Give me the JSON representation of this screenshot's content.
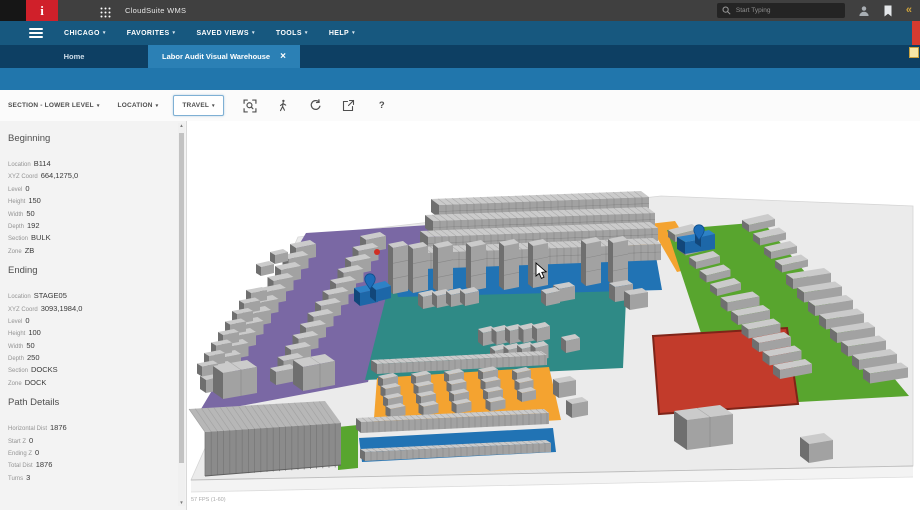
{
  "topbar": {
    "logo_letter": "i",
    "app_title": "CloudSuite WMS",
    "search_placeholder": "Start Typing"
  },
  "menubar": {
    "items": [
      "CHICAGO",
      "FAVORITES",
      "SAVED VIEWS",
      "TOOLS",
      "HELP"
    ]
  },
  "tabs": {
    "items": [
      {
        "label": "Home",
        "active": false
      },
      {
        "label": "Labor Audit Visual Warehouse",
        "active": true,
        "closable": true
      }
    ]
  },
  "toolbar": {
    "dropdowns": [
      "SECTION - LOWER LEVEL",
      "LOCATION",
      "TRAVEL"
    ],
    "icons": [
      "zoom-fit-icon",
      "walk-icon",
      "refresh-icon",
      "export-icon",
      "help-icon"
    ]
  },
  "panel": {
    "sections": [
      {
        "title": "Beginning",
        "fields": [
          {
            "label": "Location",
            "value": "B114"
          },
          {
            "label": "XYZ Coord",
            "value": "664,1275,0"
          },
          {
            "label": "Level",
            "value": "0"
          },
          {
            "label": "Height",
            "value": "150"
          },
          {
            "label": "Width",
            "value": "50"
          },
          {
            "label": "Depth",
            "value": "192"
          },
          {
            "label": "Section",
            "value": "BULK"
          },
          {
            "label": "Zone",
            "value": "ZB"
          }
        ]
      },
      {
        "title": "Ending",
        "fields": [
          {
            "label": "Location",
            "value": "STAGE05"
          },
          {
            "label": "XYZ Coord",
            "value": "3093,1984,0"
          },
          {
            "label": "Level",
            "value": "0"
          },
          {
            "label": "Height",
            "value": "100"
          },
          {
            "label": "Width",
            "value": "50"
          },
          {
            "label": "Depth",
            "value": "250"
          },
          {
            "label": "Section",
            "value": "DOCKS"
          },
          {
            "label": "Zone",
            "value": "DOCK"
          }
        ]
      },
      {
        "title": "Path Details",
        "fields": [
          {
            "label": "Horizontal Dist",
            "value": "1876"
          },
          {
            "label": "Start Z",
            "value": "0"
          },
          {
            "label": "Ending Z",
            "value": "0"
          },
          {
            "label": "Total Dist",
            "value": "1876"
          },
          {
            "label": "Turns",
            "value": "3"
          }
        ]
      }
    ]
  },
  "scene": {
    "fps_label": "57 FPS (1-60)",
    "markers": [
      {
        "name": "begin-marker",
        "type": "blue-pin",
        "zone": "BULK"
      },
      {
        "name": "end-marker",
        "type": "blue-pin",
        "zone": "DOCK"
      },
      {
        "name": "point-marker",
        "type": "red-dot",
        "zone": "BULK"
      }
    ],
    "colors": {
      "floor": "#ebebeb",
      "floor_edge": "#d6d6d6",
      "platform_face": "#f3f3f3",
      "platform_line": "#bdbdbd",
      "purple": "#7a68a4",
      "teal": "#2f8a86",
      "blue": "#2173b4",
      "orange": "#f4a330",
      "green": "#58a52e",
      "red": "#c23b2b",
      "red_border": "#7f2418",
      "rack_top": "#cbcbcb",
      "rack_front": "#a2a2a2",
      "rack_side": "#6f6f6f",
      "seam": "rgba(0,0,0,0.16)",
      "building_top": "#b7b7b7",
      "building_front": "#8b8b8b",
      "marker_blue": "#1d6cb8",
      "marker_blue_dark": "#0e4f8c",
      "marker_red": "#d02f23"
    }
  }
}
